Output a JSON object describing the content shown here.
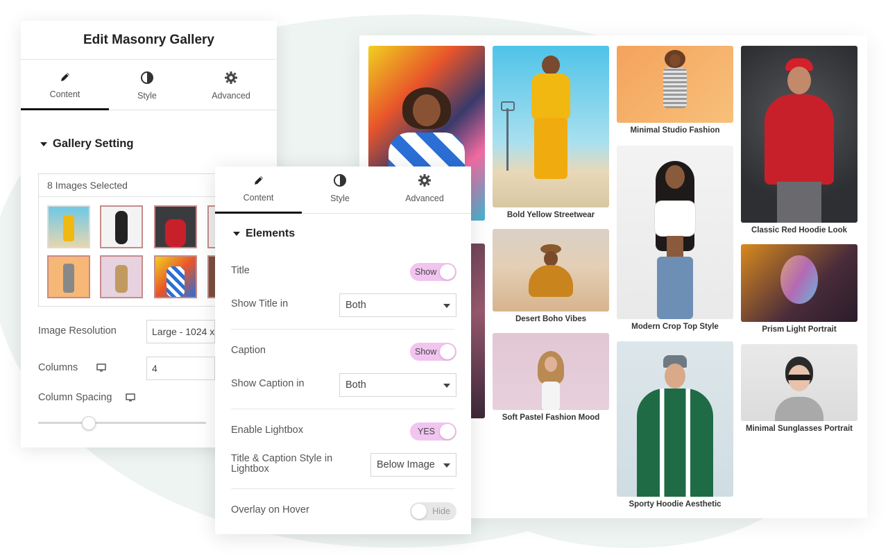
{
  "editor": {
    "title": "Edit Masonry Gallery",
    "tabs": [
      {
        "label": "Content",
        "icon": "pencil-icon",
        "active": true
      },
      {
        "label": "Style",
        "icon": "contrast-icon",
        "active": false
      },
      {
        "label": "Advanced",
        "icon": "gear-icon",
        "active": false
      }
    ],
    "section": "Gallery Setting",
    "images_selected": "8 Images Selected",
    "image_resolution": {
      "label": "Image Resolution",
      "value": "Large - 1024 x"
    },
    "columns": {
      "label": "Columns",
      "value": "4"
    },
    "column_spacing": {
      "label": "Column Spacing",
      "slider_fraction": 0.3
    }
  },
  "elements_panel": {
    "tabs": [
      {
        "label": "Content",
        "icon": "pencil-icon",
        "active": true
      },
      {
        "label": "Style",
        "icon": "contrast-icon",
        "active": false
      },
      {
        "label": "Advanced",
        "icon": "gear-icon",
        "active": false
      }
    ],
    "section": "Elements",
    "title": {
      "label": "Title",
      "toggle": "Show",
      "on": true
    },
    "show_title_in": {
      "label": "Show Title in",
      "value": "Both"
    },
    "caption": {
      "label": "Caption",
      "toggle": "Show",
      "on": true
    },
    "show_caption_in": {
      "label": "Show Caption in",
      "value": "Both"
    },
    "lightbox": {
      "label": "Enable Lightbox",
      "toggle": "YES",
      "on": true
    },
    "lightbox_style": {
      "label_line1": "Title & Caption Style in",
      "label_line2": "Lightbox",
      "value": "Below Image"
    },
    "overlay": {
      "label": "Overlay on Hover",
      "toggle": "Hide",
      "on": false
    }
  },
  "gallery": {
    "captions": [
      "Bold Yellow Streetwear",
      "Minimal Studio Fashion",
      "Classic Red Hoodie Look",
      "Desert Boho Vibes",
      "Modern Crop Top Style",
      "Prism Light Portrait",
      "Soft Pastel Fashion Mood",
      "Sporty Hoodie Aesthetic",
      "Minimal Sunglasses Portrait"
    ]
  },
  "colors": {
    "toggle_on": "#f2c4f0",
    "background_blob": "#eef4f1",
    "active_tab_underline": "#111111"
  }
}
